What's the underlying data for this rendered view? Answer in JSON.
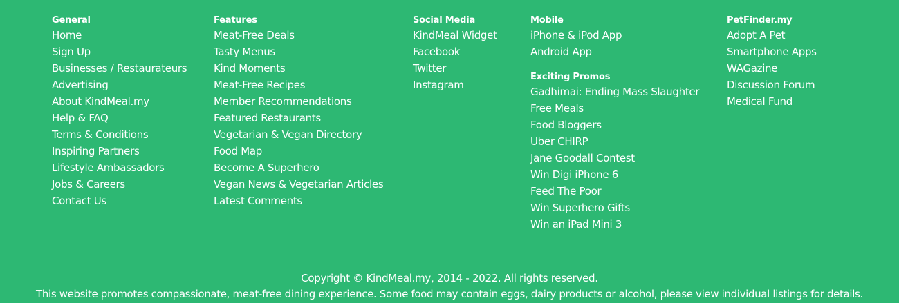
{
  "columns": {
    "general": {
      "heading": "General",
      "items": [
        "Home",
        "Sign Up",
        "Businesses / Restaurateurs",
        "Advertising",
        "About KindMeal.my",
        "Help & FAQ",
        "Terms & Conditions",
        "Inspiring Partners",
        "Lifestyle Ambassadors",
        "Jobs & Careers",
        "Contact Us"
      ]
    },
    "features": {
      "heading": "Features",
      "items": [
        "Meat-Free Deals",
        "Tasty Menus",
        "Kind Moments",
        "Meat-Free Recipes",
        "Member Recommendations",
        "Featured Restaurants",
        "Vegetarian & Vegan Directory",
        "Food Map",
        "Become A Superhero",
        "Vegan News & Vegetarian Articles",
        "Latest Comments"
      ]
    },
    "social": {
      "heading": "Social Media",
      "items": [
        "KindMeal Widget",
        "Facebook",
        "Twitter",
        "Instagram"
      ]
    },
    "mobile": {
      "heading": "Mobile",
      "items": [
        "iPhone & iPod App",
        "Android App"
      ]
    },
    "promos": {
      "heading": "Exciting Promos",
      "items": [
        "Gadhimai: Ending Mass Slaughter",
        "Free Meals",
        "Food Bloggers",
        "Uber CHIRP",
        "Jane Goodall Contest",
        "Win Digi iPhone 6",
        "Feed The Poor",
        "Win Superhero Gifts",
        "Win an iPad Mini 3"
      ]
    },
    "petfinder": {
      "heading": "PetFinder.my",
      "items": [
        "Adopt A Pet",
        "Smartphone Apps",
        "WAGazine",
        "Discussion Forum",
        "Medical Fund"
      ]
    }
  },
  "footer": {
    "copyright": "Copyright © KindMeal.my, 2014 - 2022. All rights reserved.",
    "disclaimer": "This website promotes compassionate, meat-free dining experience. Some food may contain eggs, dairy products or alcohol, please view individual listings for details."
  },
  "colors": {
    "background": "#2db873",
    "text": "#ffffff"
  }
}
